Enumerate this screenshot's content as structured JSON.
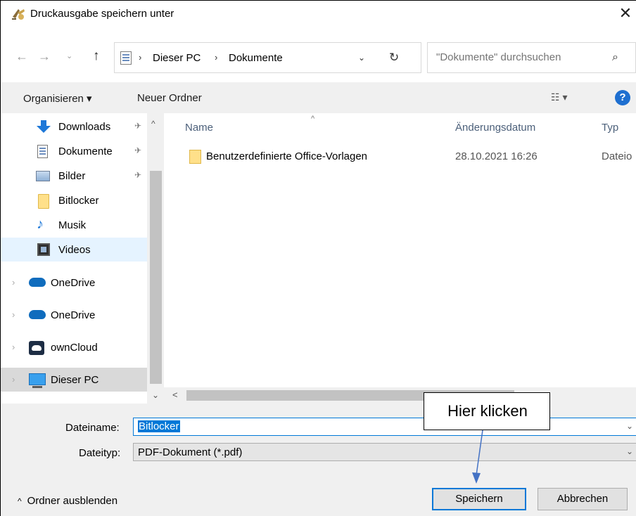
{
  "window": {
    "title": "Druckausgabe speichern unter",
    "close_glyph": "✕"
  },
  "navigation": {
    "back_glyph": "←",
    "forward_glyph": "→",
    "recent_glyph": "⌄",
    "up_glyph": "↑",
    "breadcrumb_sep": "›",
    "breadcrumb": [
      "Dieser PC",
      "Dokumente"
    ],
    "address_dropdown_glyph": "⌄",
    "refresh_glyph": "↻"
  },
  "search": {
    "placeholder": "\"Dokumente\" durchsuchen",
    "icon": "search-icon",
    "glyph": "⌕"
  },
  "toolbar": {
    "organize_label": "Organisieren ▾",
    "new_folder_label": "Neuer Ordner",
    "view_glyph": "☷ ▾",
    "help_label": "?"
  },
  "nav_pane": {
    "scroll_up": "^",
    "scroll_down": "⌄",
    "pin_glyph": "✈",
    "chevron_glyph": "›",
    "items": [
      {
        "label": "Downloads",
        "pinned": true,
        "icon": "download-icon"
      },
      {
        "label": "Dokumente",
        "pinned": true,
        "icon": "document-icon"
      },
      {
        "label": "Bilder",
        "pinned": true,
        "icon": "pictures-icon"
      },
      {
        "label": "Bitlocker",
        "pinned": false,
        "icon": "folder-icon"
      },
      {
        "label": "Musik",
        "pinned": false,
        "icon": "music-icon"
      },
      {
        "label": "Videos",
        "pinned": false,
        "icon": "videos-icon",
        "selected": true
      },
      {
        "label": "OneDrive",
        "icon": "onedrive-icon"
      },
      {
        "label": "OneDrive",
        "icon": "onedrive-icon"
      },
      {
        "label": "ownCloud",
        "icon": "owncloud-icon"
      },
      {
        "label": "Dieser PC",
        "icon": "computer-icon",
        "current": true
      }
    ]
  },
  "file_list": {
    "sort_glyph": "^",
    "columns": {
      "name": "Name",
      "date": "Änderungsdatum",
      "type": "Typ"
    },
    "rows": [
      {
        "name": "Benutzerdefinierte Office-Vorlagen",
        "date": "28.10.2021 16:26",
        "type": "Dateio"
      }
    ],
    "hscroll_left": "<"
  },
  "form": {
    "filename_label": "Dateiname:",
    "filename_value": "Bitlocker",
    "filetype_label": "Dateityp:",
    "filetype_value": "PDF-Dokument (*.pdf)",
    "dropdown_glyph": "⌄"
  },
  "buttons": {
    "save": "Speichern",
    "cancel": "Abbrechen",
    "hide_folders": "Ordner ausblenden",
    "hide_folders_caret": "^"
  },
  "annotation": {
    "text": "Hier klicken",
    "color": "#4472c4"
  }
}
